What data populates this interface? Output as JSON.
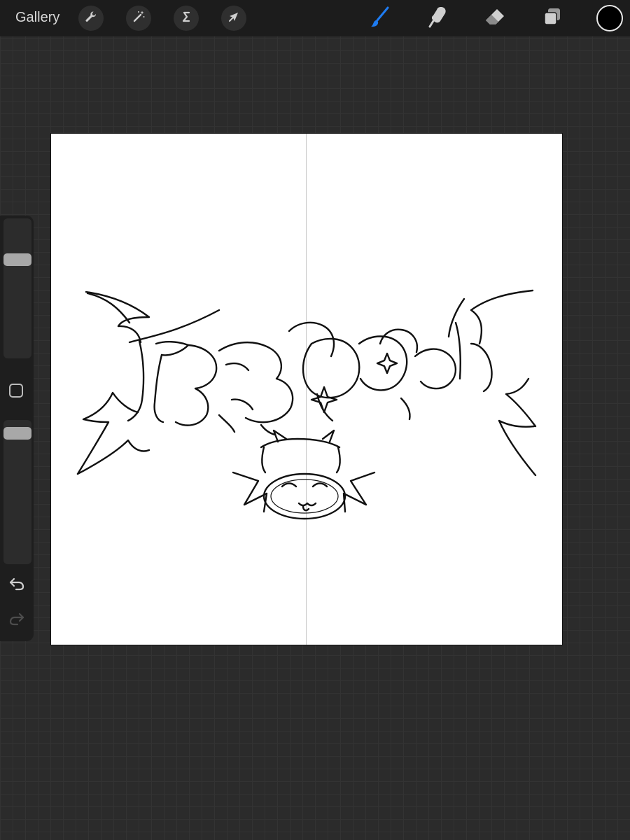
{
  "topbar": {
    "gallery_label": "Gallery",
    "left_tools": [
      {
        "name": "actions",
        "icon": "wrench-icon"
      },
      {
        "name": "adjustments",
        "icon": "magic-wand-icon"
      },
      {
        "name": "selection",
        "icon": "selection-s-icon"
      },
      {
        "name": "transform",
        "icon": "arrow-cursor-icon"
      }
    ],
    "right_tools": [
      {
        "name": "brush",
        "icon": "brush-icon",
        "active": true
      },
      {
        "name": "smudge",
        "icon": "smudge-finger-icon",
        "active": false
      },
      {
        "name": "eraser",
        "icon": "eraser-icon",
        "active": false
      },
      {
        "name": "layers",
        "icon": "layers-icon",
        "active": false
      }
    ],
    "current_color": "#000000",
    "active_color": "#1e7cf2"
  },
  "sidebar": {
    "brush_size_level": 0.28,
    "brush_opacity_level": 0.06,
    "modify_button_icon": "square-icon",
    "undo_icon": "undo-arrow-icon",
    "redo_icon": "redo-arrow-icon"
  },
  "canvas": {
    "background": "#ffffff",
    "symmetry_guide": "vertical",
    "artwork_icon": "gothic-lettering-sketch-with-cat-face-icon"
  }
}
